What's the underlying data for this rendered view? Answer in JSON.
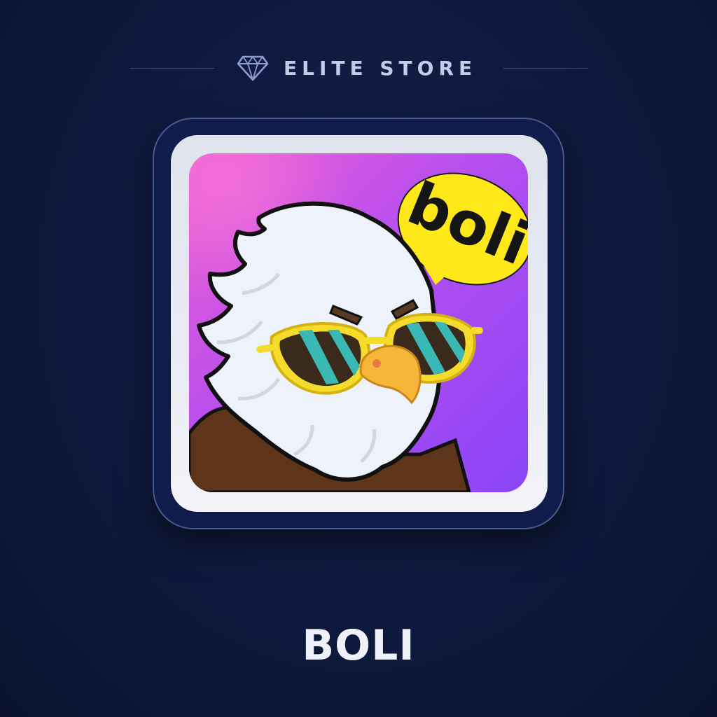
{
  "store": {
    "name": "ELITE STORE",
    "icon": "diamond-icon"
  },
  "app": {
    "name": "BOLI",
    "icon": "boli-eagle-app-icon",
    "logo_text": "boli"
  },
  "colors": {
    "background": "#0f1a40",
    "card_border": "#4b5a90",
    "icon_gradient_start": "#ea5fd2",
    "icon_gradient_end": "#8c46f6",
    "bubble": "#ffe61a",
    "sunglasses_frame": "#f5dc2a",
    "lens": "#3ab8b4",
    "beak": "#f5b63a",
    "body": "#5e351a"
  }
}
